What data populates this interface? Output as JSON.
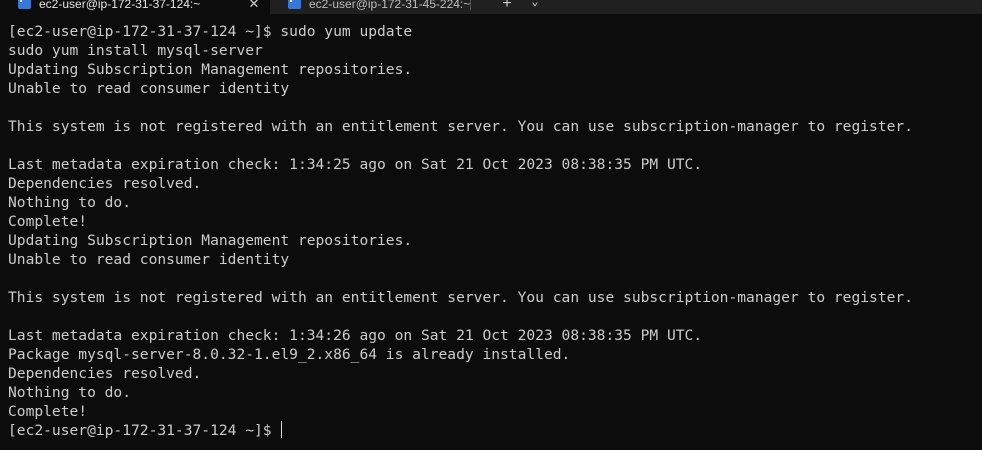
{
  "tabs": [
    {
      "label": "ec2-user@ip-172-31-37-124:~",
      "active": true,
      "close_label": "✕",
      "icon": "terminal-icon"
    },
    {
      "label": "ec2-user@ip-172-31-45-224:~",
      "active": false,
      "icon": "terminal-icon"
    }
  ],
  "new_tab_label": "+",
  "dropdown_label": "⌄",
  "colors": {
    "background": "#0c0c0c",
    "text": "#cccccc",
    "tabbar": "#202020",
    "tab_icon": "#3a78d6"
  },
  "terminal": {
    "lines": [
      "[ec2-user@ip-172-31-37-124 ~]$ sudo yum update",
      "sudo yum install mysql-server",
      "Updating Subscription Management repositories.",
      "Unable to read consumer identity",
      "",
      "This system is not registered with an entitlement server. You can use subscription-manager to register.",
      "",
      "Last metadata expiration check: 1:34:25 ago on Sat 21 Oct 2023 08:38:35 PM UTC.",
      "Dependencies resolved.",
      "Nothing to do.",
      "Complete!",
      "Updating Subscription Management repositories.",
      "Unable to read consumer identity",
      "",
      "This system is not registered with an entitlement server. You can use subscription-manager to register.",
      "",
      "Last metadata expiration check: 1:34:26 ago on Sat 21 Oct 2023 08:38:35 PM UTC.",
      "Package mysql-server-8.0.32-1.el9_2.x86_64 is already installed.",
      "Dependencies resolved.",
      "Nothing to do.",
      "Complete!"
    ],
    "prompt": "[ec2-user@ip-172-31-37-124 ~]$ "
  }
}
